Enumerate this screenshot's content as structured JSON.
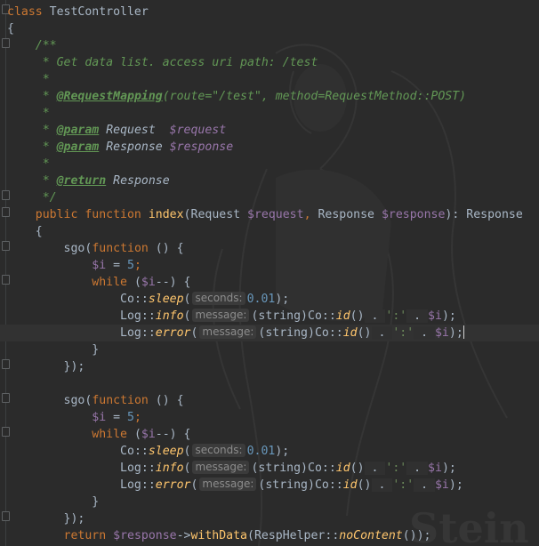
{
  "code": {
    "class_decl": {
      "keyword": "class",
      "name": "TestController"
    },
    "open_brace": "{",
    "doc": {
      "start": "/**",
      "line1": "* Get data list. access uri path: /test",
      "star": "*",
      "mapping_tag": "@RequestMapping",
      "mapping_args": "(route=\"/test\", method=RequestMethod::POST)",
      "param_tag": "@param",
      "param1_type": "Request",
      "param1_var": "$request",
      "param2_type": "Response",
      "param2_var": "$response",
      "return_tag": "@return",
      "return_type": "Response",
      "end": "*/"
    },
    "method_sig": {
      "public": "public",
      "function": "function",
      "name": "index",
      "open": "(",
      "t1": "Request",
      "v1": "$request",
      "comma": ",",
      "t2": "Response",
      "v2": "$response",
      "close": "):",
      "ret": "Response"
    },
    "sgo": "sgo",
    "function_kw": "function",
    "paren_brace": "() {",
    "i_var": "$i",
    "assign": " = ",
    "five": "5",
    "semi": ";",
    "while": "while",
    "while_cond_open": "(",
    "while_cond_close": "--) {",
    "co": "Co",
    "log": "Log",
    "dcolon": "::",
    "sleep": "sleep",
    "info": "info",
    "error": "error",
    "id": "id",
    "hint_seconds": "seconds:",
    "hint_message": "message:",
    "sleep_val": "0.01",
    "string_cast": "(string)",
    "id_call": "()",
    "concat": " . ",
    "colon_str": "':'",
    "close_call": ");",
    "close_paren_semi": ");",
    "open_paren": "(",
    "close_brace": "}",
    "close_sgo": "});",
    "return_kw": "return",
    "response_var": "$response",
    "arrow": "->",
    "with_data": "withData",
    "resp_helper": "RespHelper",
    "no_content": "noContent",
    "return_tail": "());"
  }
}
